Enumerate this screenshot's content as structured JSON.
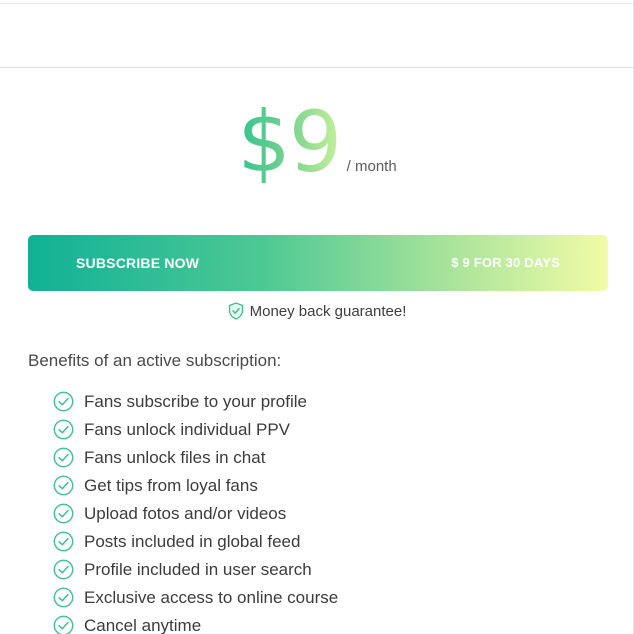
{
  "pricing": {
    "amount": "$9",
    "period": "/ month"
  },
  "subscribe": {
    "label": "SUBSCRIBE NOW",
    "price_text": "$ 9 FOR 30 DAYS"
  },
  "guarantee": {
    "text": "Money back guarantee!",
    "icon": "shield-check-icon"
  },
  "benefits": {
    "title": "Benefits of an active subscription:",
    "icon": "check-circle-icon",
    "items": [
      "Fans subscribe to your profile",
      "Fans unlock individual PPV",
      "Fans unlock files in chat",
      "Get tips from loyal fans",
      "Upload fotos and/or videos",
      "Posts included in global feed",
      "Profile included in user search",
      "Exclusive access to online course",
      "Cancel anytime"
    ]
  },
  "colors": {
    "accent_start": "#10b196",
    "accent_end": "#f2fba6",
    "check": "#3fbf8f"
  }
}
